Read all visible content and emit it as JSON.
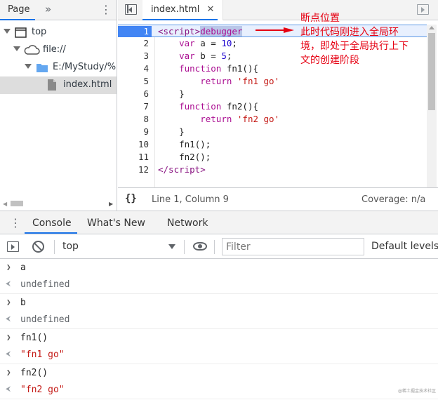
{
  "navigator": {
    "tab": "Page",
    "more_glyph": "»",
    "menu_glyph": "⋮",
    "tree": [
      {
        "label": "top",
        "icon": "frame-icon",
        "level": 0,
        "expanded": true
      },
      {
        "label": "file://",
        "icon": "cloud-icon",
        "level": 1,
        "expanded": true
      },
      {
        "label": "E:/MyStudy/%",
        "icon": "folder-icon",
        "level": 2,
        "expanded": true
      },
      {
        "label": "index.html",
        "icon": "file-icon",
        "level": 3,
        "selected": true
      }
    ]
  },
  "editor": {
    "file_tab": "index.html",
    "close_glyph": "✕",
    "paused_line": 1,
    "lines": [
      "1",
      "2",
      "3",
      "4",
      "5",
      "6",
      "7",
      "8",
      "9",
      "10",
      "11",
      "12"
    ],
    "status": {
      "braces": "{}",
      "position": "Line 1, Column 9",
      "coverage": "Coverage: n/a"
    }
  },
  "annotation": {
    "text": "断点位置\n此时代码刚进入全局环境，即处于全局执行上下文的创建阶段",
    "line1": "断点位置",
    "line2": "此时代码刚进入全局环",
    "line3": "境，即处于全局执行上下",
    "line4": "文的创建阶段",
    "color": "#e60012"
  },
  "drawer": {
    "menu_glyph": "⋮",
    "tabs": [
      "Console",
      "What's New",
      "Network"
    ],
    "active_tab": "Console"
  },
  "console": {
    "context": "top",
    "filter_placeholder": "Filter",
    "levels": "Default levels",
    "entries": [
      {
        "input": "a",
        "output": "undefined",
        "type": "undefined"
      },
      {
        "input": "b",
        "output": "undefined",
        "type": "undefined"
      },
      {
        "input": "fn1()",
        "output": "\"fn1 go\"",
        "type": "string"
      },
      {
        "input": "fn2()",
        "output": "\"fn2 go\"",
        "type": "string"
      }
    ]
  },
  "watermark": "@稀土掘金技术社区"
}
